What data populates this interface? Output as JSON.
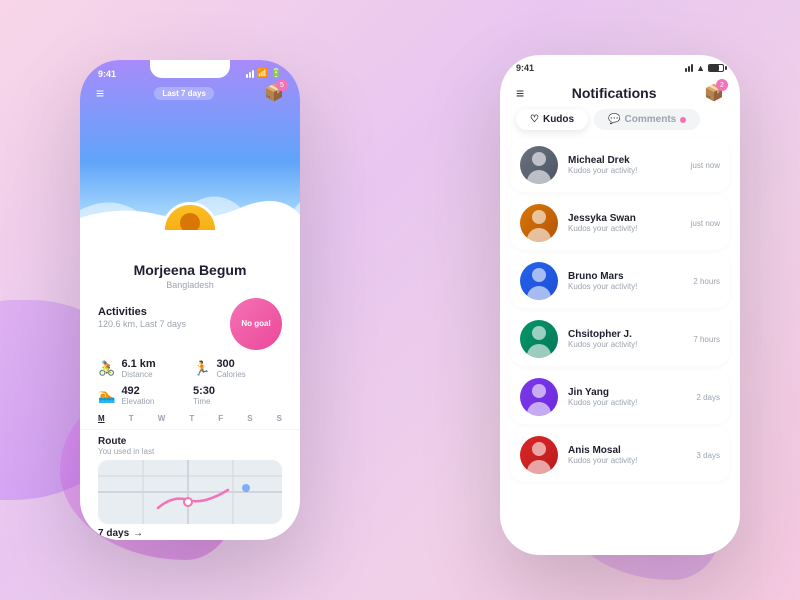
{
  "background": {
    "color": "#f5c8e8"
  },
  "left_phone": {
    "status_bar": {
      "time": "9:41",
      "last7": "Last 7 days"
    },
    "profile": {
      "name": "Morjeena Begum",
      "country": "Bangladesh",
      "badge_count": "5"
    },
    "activities": {
      "title": "Activities",
      "km_label": "120.6 km, Last 7 days",
      "no_goal": "No goal",
      "stats": [
        {
          "icon": "bike-icon",
          "value": "6.1 km",
          "label": "Distance"
        },
        {
          "icon": "calories-icon",
          "value": "300",
          "label": "Calories"
        },
        {
          "icon": "elevation-icon",
          "value": "492",
          "label": "Elevation"
        },
        {
          "icon": "time-icon",
          "value": "5:30",
          "label": "Time"
        }
      ],
      "days": [
        "M",
        "T",
        "W",
        "T",
        "F",
        "S",
        "S"
      ],
      "active_day": "M"
    },
    "route": {
      "title": "Route",
      "subtitle": "You used in last",
      "days": "7 days"
    }
  },
  "right_phone": {
    "status_bar": {
      "time": "9:41"
    },
    "header": {
      "title": "Notifications",
      "badge_count": "2"
    },
    "tabs": [
      {
        "id": "kudos",
        "label": "Kudos",
        "active": true,
        "icon": "heart-icon"
      },
      {
        "id": "comments",
        "label": "Comments",
        "active": false,
        "icon": "comment-icon",
        "dot": true
      }
    ],
    "notifications": [
      {
        "id": 1,
        "name": "Micheal Drek",
        "action": "Kudos your activity!",
        "time": "just now",
        "avatar_class": "av-1"
      },
      {
        "id": 2,
        "name": "Jessyka Swan",
        "action": "Kudos your activity!",
        "time": "just now",
        "avatar_class": "av-2"
      },
      {
        "id": 3,
        "name": "Bruno Mars",
        "action": "Kudos your activity!",
        "time": "2 hours",
        "avatar_class": "av-3"
      },
      {
        "id": 4,
        "name": "Chsitopher J.",
        "action": "Kudos your activity!",
        "time": "7 hours",
        "avatar_class": "av-4"
      },
      {
        "id": 5,
        "name": "Jin Yang",
        "action": "Kudos your activity!",
        "time": "2 days",
        "avatar_class": "av-5"
      },
      {
        "id": 6,
        "name": "Anis Mosal",
        "action": "Kudos your activity!",
        "time": "3 days",
        "avatar_class": "av-6"
      }
    ]
  }
}
